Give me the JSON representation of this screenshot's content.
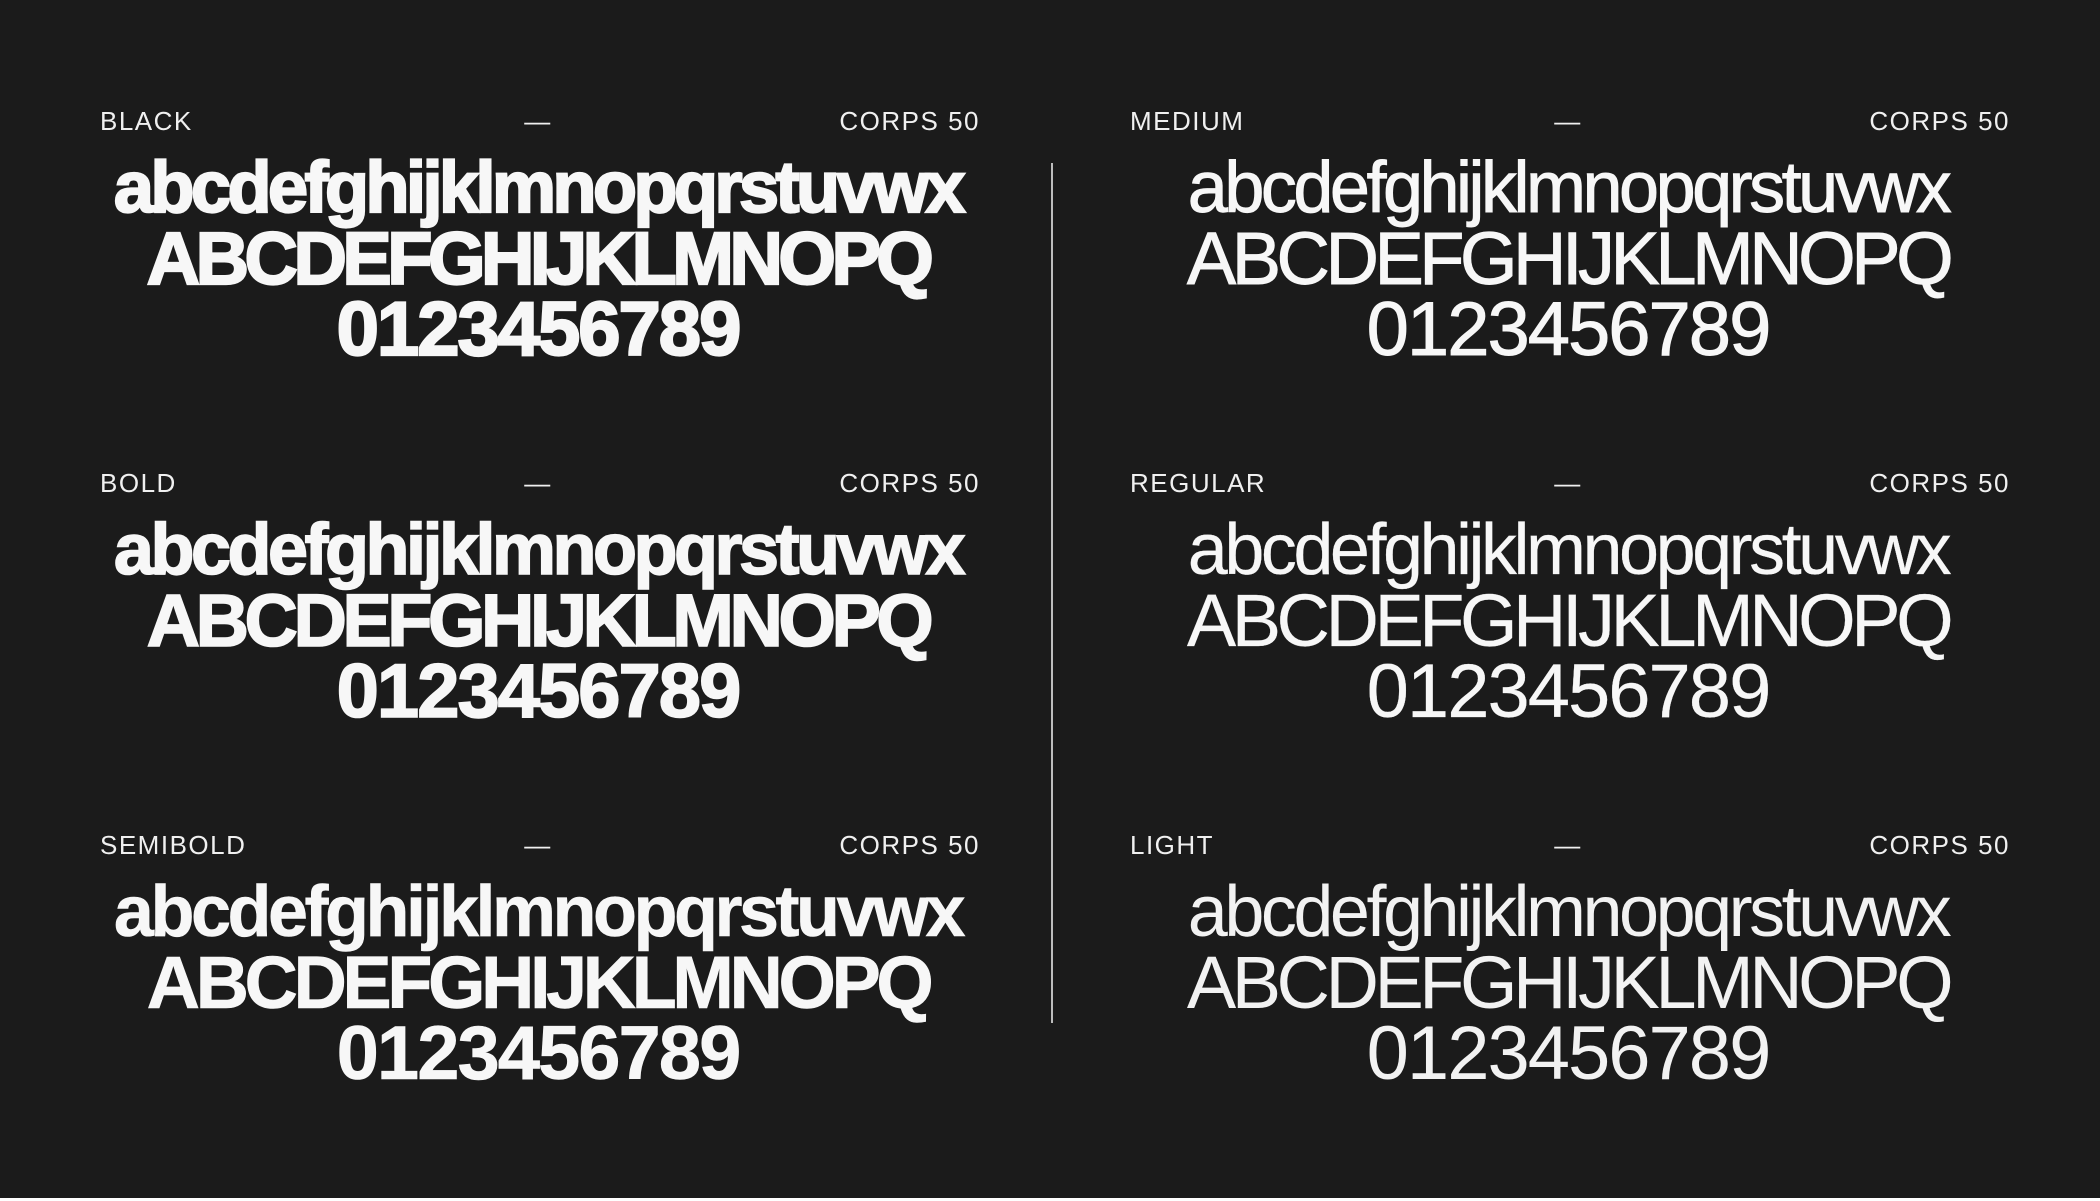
{
  "colors": {
    "background": "#1b1b1b",
    "text": "#f5f5f5",
    "divider": "#bdbdbd"
  },
  "specimens": [
    {
      "name": "BLACK",
      "separator": "—",
      "size_label": "CORPS 50",
      "lowercase": "abcdefghijklmnopqrstuvwx",
      "uppercase": "ABCDEFGHIJKLMNOPQ",
      "digits": "0123456789"
    },
    {
      "name": "BOLD",
      "separator": "—",
      "size_label": "CORPS 50",
      "lowercase": "abcdefghijklmnopqrstuvwx",
      "uppercase": "ABCDEFGHIJKLMNOPQ",
      "digits": "0123456789"
    },
    {
      "name": "SEMIBOLD",
      "separator": "—",
      "size_label": "CORPS 50",
      "lowercase": "abcdefghijklmnopqrstuvwx",
      "uppercase": "ABCDEFGHIJKLMNOPQ",
      "digits": "0123456789"
    },
    {
      "name": "MEDIUM",
      "separator": "—",
      "size_label": "CORPS 50",
      "lowercase": "abcdefghijklmnopqrstuvwx",
      "uppercase": "ABCDEFGHIJKLMNOPQ",
      "digits": "0123456789"
    },
    {
      "name": "REGULAR",
      "separator": "—",
      "size_label": "CORPS 50",
      "lowercase": "abcdefghijklmnopqrstuvwx",
      "uppercase": "ABCDEFGHIJKLMNOPQ",
      "digits": "0123456789"
    },
    {
      "name": "LIGHT",
      "separator": "—",
      "size_label": "CORPS 50",
      "lowercase": "abcdefghijklmnopqrstuvwx",
      "uppercase": "ABCDEFGHIJKLMNOPQ",
      "digits": "0123456789"
    }
  ]
}
